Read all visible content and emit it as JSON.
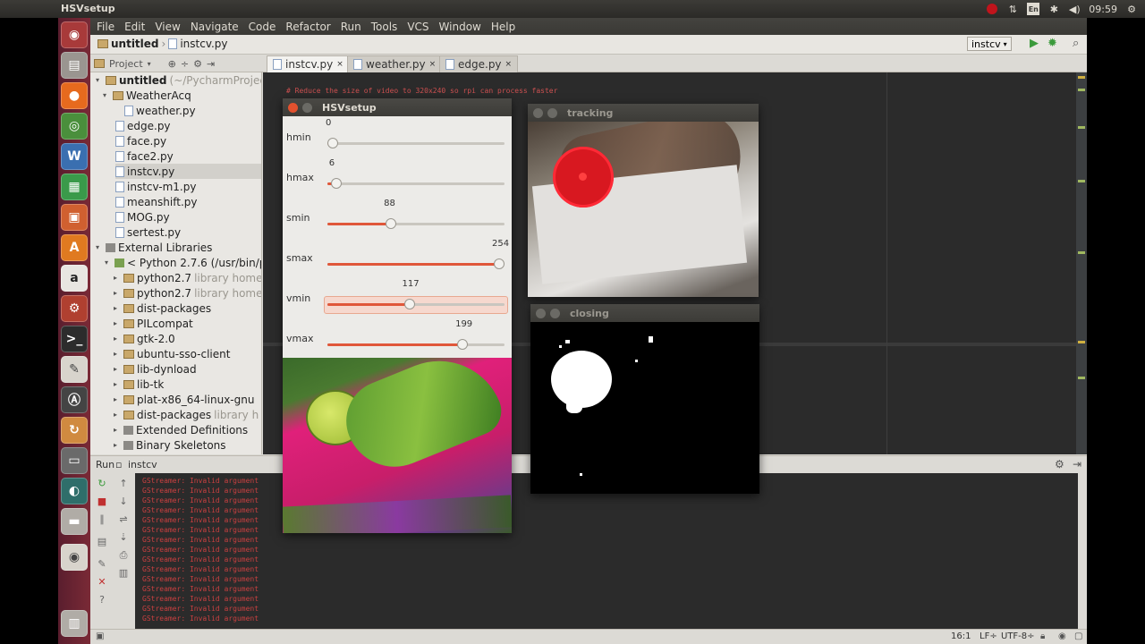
{
  "window_title": "HSVsetup",
  "tray": {
    "time": "09:59"
  },
  "menu": [
    "File",
    "Edit",
    "View",
    "Navigate",
    "Code",
    "Refactor",
    "Run",
    "Tools",
    "VCS",
    "Window",
    "Help"
  ],
  "breadcrumb": {
    "project": "untitled",
    "file": "instcv.py"
  },
  "run_config": "instcv",
  "project_panel": {
    "label": "Project"
  },
  "tabs": [
    "instcv.py",
    "weather.py",
    "edge.py"
  ],
  "tree": [
    {
      "label": "untitled",
      "note": "(~/PycharmProject",
      "type": "root"
    },
    {
      "label": "WeatherAcq",
      "note": "",
      "type": "folder"
    },
    {
      "label": "weather.py",
      "note": "",
      "type": "py"
    },
    {
      "label": "edge.py",
      "note": "",
      "type": "py"
    },
    {
      "label": "face.py",
      "note": "",
      "type": "py"
    },
    {
      "label": "face2.py",
      "note": "",
      "type": "py"
    },
    {
      "label": "instcv.py",
      "note": "",
      "type": "py"
    },
    {
      "label": "instcv-m1.py",
      "note": "",
      "type": "py"
    },
    {
      "label": "meanshift.py",
      "note": "",
      "type": "py"
    },
    {
      "label": "MOG.py",
      "note": "",
      "type": "py"
    },
    {
      "label": "sertest.py",
      "note": "",
      "type": "py"
    },
    {
      "label": "External Libraries",
      "note": "",
      "type": "lib"
    },
    {
      "label": "< Python 2.7.6 (/usr/bin/p",
      "note": "",
      "type": "sdk"
    },
    {
      "label": "python2.7",
      "note": "library home",
      "type": "folder"
    },
    {
      "label": "python2.7",
      "note": "library home",
      "type": "folder"
    },
    {
      "label": "dist-packages",
      "note": "",
      "type": "folder"
    },
    {
      "label": "PILcompat",
      "note": "",
      "type": "folder"
    },
    {
      "label": "gtk-2.0",
      "note": "",
      "type": "folder"
    },
    {
      "label": "ubuntu-sso-client",
      "note": "",
      "type": "folder"
    },
    {
      "label": "lib-dynload",
      "note": "",
      "type": "folder"
    },
    {
      "label": "lib-tk",
      "note": "",
      "type": "folder"
    },
    {
      "label": "plat-x86_64-linux-gnu",
      "note": "",
      "type": "folder"
    },
    {
      "label": "dist-packages",
      "note": "library h",
      "type": "folder"
    },
    {
      "label": "Extended Definitions",
      "note": "",
      "type": "lib"
    },
    {
      "label": "Binary Skeletons",
      "note": "",
      "type": "lib"
    }
  ],
  "editor": {
    "line1": "# Reduce the size of video to 320x240 so rpi can process faster"
  },
  "run_panel": {
    "label": "Run",
    "config": "instcv",
    "error_text": "GStreamer: Invalid argument"
  },
  "hsv_window": {
    "title": "HSVsetup",
    "sliders": [
      {
        "label": "hmin",
        "value": "0",
        "level": 0.0,
        "highlighted": false
      },
      {
        "label": "hmax",
        "value": "6",
        "level": 0.02,
        "highlighted": false
      },
      {
        "label": "smin",
        "value": "88",
        "level": 0.35,
        "highlighted": false
      },
      {
        "label": "smax",
        "value": "254",
        "level": 1.0,
        "highlighted": false
      },
      {
        "label": "vmin",
        "value": "117",
        "level": 0.46,
        "highlighted": true
      },
      {
        "label": "vmax",
        "value": "199",
        "level": 0.78,
        "highlighted": false
      }
    ]
  },
  "tracking_window": {
    "title": "tracking"
  },
  "closing_window": {
    "title": "closing"
  },
  "status": {
    "position": "16:1",
    "line_sep": "LF÷",
    "encoding": "UTF-8÷"
  },
  "colors": {
    "accent": "#e0573a",
    "launcher": "#7a2a36",
    "editor_bg": "#2b2b2b"
  },
  "launcher_icons": [
    "ubuntu-icon",
    "files-icon",
    "firefox-icon",
    "chrome-icon",
    "writer-icon",
    "calc-icon",
    "impress-icon",
    "software-icon",
    "amazon-icon",
    "settings-icon",
    "terminal-icon",
    "editor-icon",
    "pycharm-icon",
    "update-icon",
    "bulb-icon",
    "drive-icon",
    "trash-icon"
  ]
}
